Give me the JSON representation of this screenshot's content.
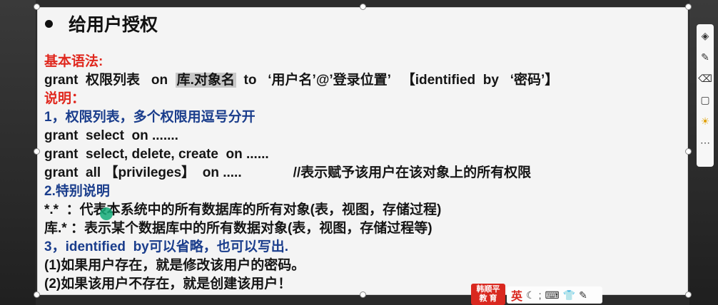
{
  "slide": {
    "title": "给用户授权",
    "lines": [
      {
        "parts": [
          {
            "text": "基本语法:",
            "color": "red"
          }
        ]
      },
      {
        "parts": [
          {
            "text": "grant  权限列表   on  ",
            "color": "black"
          },
          {
            "text": "库.对象名",
            "color": "black",
            "highlight": true
          },
          {
            "text": "  to   ‘用户名’@’登录位置’   【identified  by   ‘密码’】",
            "color": "black"
          }
        ]
      },
      {
        "parts": [
          {
            "text": "说明：",
            "color": "red"
          }
        ]
      },
      {
        "parts": [
          {
            "text": "1，权限列表，多个权限用逗号分开",
            "color": "blue"
          }
        ]
      },
      {
        "parts": [
          {
            "text": "grant  select  on .......",
            "color": "black"
          }
        ]
      },
      {
        "parts": [
          {
            "text": "grant  select, delete, create  on ......",
            "color": "black"
          }
        ]
      },
      {
        "parts": [
          {
            "text": "grant  all 【privileges】  on .....",
            "color": "black"
          },
          {
            "text": "//表示赋予该用户在该对象上的所有权限",
            "color": "black",
            "gap": true
          }
        ]
      },
      {
        "parts": [
          {
            "text": "2.特别说明",
            "color": "blue"
          }
        ]
      },
      {
        "parts": [
          {
            "text": "*.*  ：代表本系统中的所有数据库的所有对象(表，视图，存储过程)",
            "color": "black"
          }
        ]
      },
      {
        "parts": [
          {
            "text": "库.* ：表示某个数据库中的所有数据对象(表，视图，存储过程等)",
            "color": "black"
          }
        ]
      },
      {
        "parts": [
          {
            "text": "3，identified  by可以省略，也可以写出.",
            "color": "blue"
          }
        ]
      },
      {
        "parts": [
          {
            "text": "(1)如果用户存在，就是修改该用户的密码。",
            "color": "black"
          }
        ]
      },
      {
        "parts": [
          {
            "text": "(2)如果该用户不存在，就是创建该用户！",
            "color": "black"
          }
        ]
      }
    ]
  },
  "toolbar": {
    "tools": [
      {
        "icon": "layers-icon",
        "glyph": "◈"
      },
      {
        "icon": "pen-icon",
        "glyph": "✎"
      },
      {
        "icon": "eraser-icon",
        "glyph": "⌫"
      },
      {
        "icon": "page-icon",
        "glyph": "▢"
      },
      {
        "icon": "bulb-icon",
        "glyph": "☀"
      },
      {
        "icon": "more-icon",
        "glyph": "⋯"
      }
    ]
  },
  "watermark": {
    "line1": "韩顺平",
    "line2": "教 育"
  },
  "ime": {
    "lang": "英",
    "glyphs": [
      "☾",
      ";",
      "⌨",
      "👕",
      "✎"
    ]
  },
  "colors": {
    "red": "#e0281e",
    "blue": "#1a3d8c",
    "black": "#151515"
  }
}
